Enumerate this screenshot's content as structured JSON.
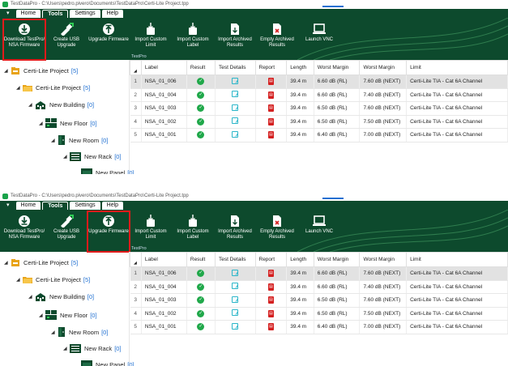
{
  "window": {
    "title": "TestDataPro - C:\\Users\\pedro.pivero\\Documents\\TestDataPro\\Certi-Lite Project.tpp"
  },
  "menu": {
    "tabs": [
      "Home",
      "Tools",
      "Settings",
      "Help"
    ],
    "active": "Tools"
  },
  "ribbon": {
    "buttons": [
      {
        "label": "Download TestPro/ NSA Firmware",
        "icon": "download-icon"
      },
      {
        "label": "Create USB Upgrade",
        "icon": "usb-upgrade-icon"
      },
      {
        "label": "Upgrade Firmware",
        "icon": "upload-icon"
      },
      {
        "label": "Import Custom Limit",
        "icon": "import-limit-icon"
      },
      {
        "label": "Import Custom Label",
        "icon": "import-label-icon"
      },
      {
        "label": "Import Archived Results",
        "icon": "archive-import-icon"
      },
      {
        "label": "Empty Archived Results",
        "icon": "archive-empty-icon"
      },
      {
        "label": "Launch VNC",
        "icon": "laptop-icon"
      }
    ],
    "group_label": "TestPro",
    "highlighted": [
      "Download TestPro/ NSA Firmware",
      "Upgrade Firmware"
    ]
  },
  "tree": [
    {
      "label": "Certi-Lite Project",
      "count": "[5]",
      "icon": "project-icon"
    },
    {
      "label": "Certi-Lite Project",
      "count": "[5]",
      "icon": "folder-icon"
    },
    {
      "label": "New Building",
      "count": "[0]",
      "icon": "building-icon"
    },
    {
      "label": "New Floor",
      "count": "[0]",
      "icon": "floor-icon"
    },
    {
      "label": "New Room",
      "count": "[0]",
      "icon": "room-icon"
    },
    {
      "label": "New Rack",
      "count": "[0]",
      "icon": "rack-icon"
    },
    {
      "label": "New Panel",
      "count": "[0]",
      "icon": "panel-icon"
    }
  ],
  "table": {
    "columns": [
      "Label",
      "Result",
      "Test Details",
      "Report",
      "Length",
      "Worst Margin",
      "Worst Margin",
      "Limit"
    ],
    "rows": [
      {
        "n": "1",
        "label": "NSA_01_006",
        "length": "39.4 m",
        "wm1": "6.60 dB (RL)",
        "wm2": "7.60 dB (NEXT)",
        "limit": "Certi-Lite TIA - Cat 6A Channel"
      },
      {
        "n": "2",
        "label": "NSA_01_004",
        "length": "39.4 m",
        "wm1": "6.60 dB (RL)",
        "wm2": "7.40 dB (NEXT)",
        "limit": "Certi-Lite TIA - Cat 6A Channel"
      },
      {
        "n": "3",
        "label": "NSA_01_003",
        "length": "39.4 m",
        "wm1": "6.50 dB (RL)",
        "wm2": "7.60 dB (NEXT)",
        "limit": "Certi-Lite TIA - Cat 6A Channel"
      },
      {
        "n": "4",
        "label": "NSA_01_002",
        "length": "39.4 m",
        "wm1": "6.50 dB (RL)",
        "wm2": "7.50 dB (NEXT)",
        "limit": "Certi-Lite TIA - Cat 6A Channel"
      },
      {
        "n": "5",
        "label": "NSA_01_001",
        "length": "39.4 m",
        "wm1": "6.40 dB (RL)",
        "wm2": "7.00 dB (NEXT)",
        "limit": "Certi-Lite TIA - Cat 6A Channel"
      }
    ]
  },
  "colors": {
    "ribbon": "#0d4a2d",
    "highlight": "#e21b1b",
    "pass": "#20a84a",
    "link": "#1f6fd1"
  }
}
